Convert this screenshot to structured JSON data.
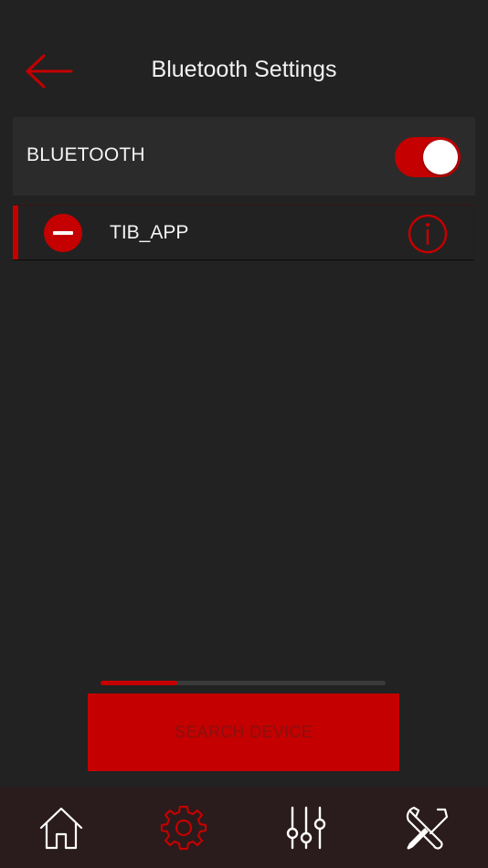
{
  "header": {
    "title": "Bluetooth Settings",
    "back_icon": "arrow-left-icon"
  },
  "bluetooth": {
    "label": "BLUETOOTH",
    "enabled": true
  },
  "devices": [
    {
      "name": "TIB_APP",
      "remove_icon": "minus-circle-icon",
      "info_icon": "info-circle-icon"
    }
  ],
  "search": {
    "progress": 0.27,
    "button_label": "SEARCH DEVICE"
  },
  "tabbar": {
    "tabs": [
      {
        "icon": "home-icon",
        "active": false
      },
      {
        "icon": "gear-icon",
        "active": true
      },
      {
        "icon": "sliders-icon",
        "active": false
      },
      {
        "icon": "tools-icon",
        "active": false
      }
    ]
  },
  "colors": {
    "accent": "#c40000",
    "background": "#222222",
    "row_background": "#2b2b2b",
    "tabbar_background": "#2a1b1c",
    "button_text": "#8a1010",
    "icon_inactive": "#ffffff"
  }
}
